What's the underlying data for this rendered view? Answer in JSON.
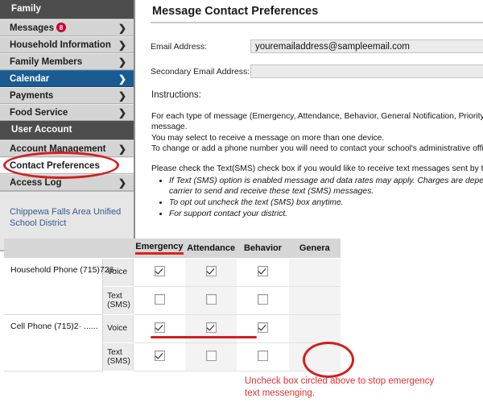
{
  "sidebar": {
    "sections": [
      {
        "header": "Family",
        "items": [
          {
            "label": "Messages",
            "badge": "8",
            "chevron": "❯",
            "state": "normal"
          },
          {
            "label": "Household Information",
            "badge": "",
            "chevron": "❯",
            "state": "normal"
          },
          {
            "label": "Family Members",
            "badge": "",
            "chevron": "❯",
            "state": "normal"
          },
          {
            "label": "Calendar",
            "badge": "",
            "chevron": "❯",
            "state": "selected"
          },
          {
            "label": "Payments",
            "badge": "",
            "chevron": "❯",
            "state": "normal"
          },
          {
            "label": "Food Service",
            "badge": "",
            "chevron": "❯",
            "state": "normal"
          }
        ]
      },
      {
        "header": "User Account",
        "items": [
          {
            "label": "Account Management",
            "badge": "",
            "chevron": "❯",
            "state": "normal"
          },
          {
            "label": "Contact Preferences",
            "badge": "",
            "chevron": "",
            "state": "active-white"
          },
          {
            "label": "Access Log",
            "badge": "",
            "chevron": "❯",
            "state": "normal"
          }
        ]
      }
    ],
    "district_name": "Chippewa Falls Area Unified School District"
  },
  "main": {
    "page_title": "Message Contact Preferences",
    "fields": [
      {
        "label": "Email Address:",
        "value": "youremailaddress@sampleemail.com",
        "placeholder": ""
      },
      {
        "label": "Secondary Email Address:",
        "value": "",
        "placeholder": ""
      }
    ],
    "instructions_heading": "Instructions:",
    "instructions_lines": [
      "For each type of message (Emergency, Attendance, Behavior, General Notification, Priority No",
      "message.",
      "You may select to receive a message on more than one device.",
      "To change or add a phone number you will need to contact your school's administrative office"
    ],
    "sms_lead": "Please check the Text(SMS) check box if you would like to receive text messages sent by the",
    "sms_bullets": [
      "If Text (SMS) option is enabled message and data rates may apply. Charges are depend carrier to send and receive these text (SMS) messages.",
      "To opt out uncheck the text (SMS) box anytime.",
      "For support contact your district."
    ]
  },
  "table": {
    "headers": {
      "phone": "",
      "mode": "",
      "emergency": "Emergency",
      "attendance": "Attendance",
      "behavior": "Behavior",
      "general": "Genera"
    },
    "rows": [
      {
        "phone": "Household Phone (715)726-",
        "modes": [
          {
            "mode": "Voice",
            "emergency": true,
            "attendance": true,
            "behavior": true,
            "general": false
          },
          {
            "mode": "Text (SMS)",
            "emergency": false,
            "attendance": false,
            "behavior": false,
            "general": false
          }
        ]
      },
      {
        "phone": "Cell Phone (715)2· ......",
        "modes": [
          {
            "mode": "Voice",
            "emergency": true,
            "attendance": true,
            "behavior": true,
            "general": false
          },
          {
            "mode": "Text (SMS)",
            "emergency": true,
            "attendance": false,
            "behavior": false,
            "general": false
          }
        ]
      }
    ]
  },
  "annotations": {
    "caption": "Uncheck box circled above to stop emergency text messenging.",
    "accent_color": "#d21f1f",
    "caption_color": "#e03030"
  }
}
